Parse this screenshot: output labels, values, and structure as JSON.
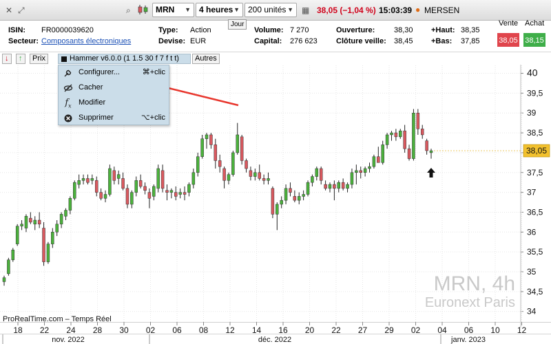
{
  "toolbar": {
    "symbol": "MRN",
    "timeframe": "4 heures",
    "units": "200 unités",
    "price_change": "38,05 (−1,04 %)",
    "time": "15:03:39",
    "instrument_name": "MERSEN"
  },
  "info": {
    "isin_label": "ISIN:",
    "isin_value": "FR0000039620",
    "sector_label": "Secteur:",
    "sector_value": "Composants électroniques",
    "type_label": "Type:",
    "type_value": "Action",
    "currency_label": "Devise:",
    "currency_value": "EUR",
    "day_button": "Jour",
    "volume_label": "Volume:",
    "volume_value": "7 270",
    "capital_label": "Capital:",
    "capital_value": "276 623",
    "open_label": "Ouverture:",
    "open_value": "38,30",
    "prev_close_label": "Clôture veille:",
    "prev_close_value": "38,45",
    "high_label": "+Haut:",
    "high_value": "38,35",
    "low_label": "+Bas:",
    "low_value": "37,85",
    "sell_label": "Vente",
    "sell_value": "38,05",
    "buy_label": "Achat",
    "buy_value": "38,15"
  },
  "legend_bar": {
    "price_label": "Prix",
    "indicator_label": "Hammer v6.0.0 (1 1.5 30 f 7 f t t)",
    "others_label": "Autres"
  },
  "context_menu": {
    "items": [
      {
        "label": "Configurer...",
        "shortcut": "⌘+clic",
        "icon": "wrench-icon"
      },
      {
        "label": "Cacher",
        "shortcut": "",
        "icon": "eye-slash-icon"
      },
      {
        "label": "Modifier",
        "shortcut": "",
        "icon": "function-icon"
      },
      {
        "label": "Supprimer",
        "shortcut": "⌥+clic",
        "icon": "delete-icon"
      }
    ]
  },
  "colors": {
    "bull": "#4bb13c",
    "bear": "#d9595f",
    "wick": "#222222",
    "price_tag": "#f2c12e",
    "sell": "#e0454c",
    "buy": "#3fae49",
    "arrow": "#e8372e",
    "grid": "#e6e6e6"
  },
  "chart_data": {
    "type": "candlestick",
    "ylim": [
      33.7,
      40.2
    ],
    "yticks": [
      "34",
      "34,5",
      "35",
      "35,5",
      "36",
      "36,5",
      "37",
      "37,5",
      "38",
      "38,5",
      "39",
      "39,5",
      "40"
    ],
    "yticks_values": [
      34,
      34.5,
      35,
      35.5,
      36,
      36.5,
      37,
      37.5,
      38,
      38.5,
      39,
      39.5,
      40
    ],
    "xticks": [
      "18",
      "22",
      "24",
      "28",
      "30",
      "02",
      "06",
      "08",
      "12",
      "14",
      "16",
      "20",
      "22",
      "27",
      "29",
      "02",
      "04",
      "06",
      "10",
      "12"
    ],
    "month_labels": [
      "nov. 2022",
      "déc. 2022",
      "janv. 2023"
    ],
    "last_price": "38,05",
    "last_price_value": 38.05,
    "watermark_symbol": "MRN, 4h",
    "watermark_exchange": "Euronext Paris",
    "source": "ProRealTime.com – Temps Réel",
    "candles": [
      [
        34.75,
        34.9,
        34.65,
        34.85
      ],
      [
        34.95,
        35.35,
        34.9,
        35.3
      ],
      [
        35.3,
        35.6,
        35.25,
        35.55
      ],
      [
        35.7,
        36.2,
        35.65,
        36.15
      ],
      [
        36.15,
        36.3,
        36.05,
        36.2
      ],
      [
        36.1,
        36.45,
        36.0,
        36.4
      ],
      [
        36.35,
        36.5,
        36.2,
        36.25
      ],
      [
        36.2,
        36.4,
        36.05,
        36.3
      ],
      [
        36.3,
        36.5,
        36.1,
        36.2
      ],
      [
        36.1,
        36.25,
        35.15,
        35.25
      ],
      [
        35.25,
        35.75,
        35.2,
        35.7
      ],
      [
        35.7,
        36.1,
        35.6,
        36.0
      ],
      [
        36.0,
        36.3,
        35.9,
        36.2
      ],
      [
        36.2,
        36.5,
        36.1,
        36.45
      ],
      [
        36.4,
        36.6,
        36.3,
        36.55
      ],
      [
        36.55,
        36.9,
        36.45,
        36.85
      ],
      [
        36.85,
        37.3,
        36.8,
        37.25
      ],
      [
        37.2,
        37.45,
        37.1,
        37.3
      ],
      [
        37.3,
        37.45,
        37.2,
        37.35
      ],
      [
        37.35,
        37.45,
        37.2,
        37.25
      ],
      [
        37.3,
        37.45,
        37.2,
        37.35
      ],
      [
        37.3,
        37.4,
        36.9,
        37.0
      ],
      [
        37.0,
        37.1,
        36.8,
        36.85
      ],
      [
        36.85,
        37.05,
        36.75,
        36.95
      ],
      [
        36.95,
        37.7,
        36.9,
        37.6
      ],
      [
        37.55,
        37.65,
        37.2,
        37.3
      ],
      [
        37.35,
        37.55,
        37.2,
        37.45
      ],
      [
        37.35,
        37.5,
        37.05,
        37.1
      ],
      [
        37.1,
        37.2,
        36.6,
        36.7
      ],
      [
        36.7,
        37.05,
        36.6,
        37.0
      ],
      [
        37.0,
        37.4,
        36.9,
        37.3
      ],
      [
        37.3,
        37.45,
        37.1,
        37.15
      ],
      [
        37.15,
        37.25,
        36.95,
        37.05
      ],
      [
        37.0,
        37.1,
        36.6,
        36.85
      ],
      [
        36.9,
        37.2,
        36.8,
        37.15
      ],
      [
        37.1,
        37.7,
        37.0,
        37.6
      ],
      [
        37.55,
        37.7,
        37.0,
        37.1
      ],
      [
        37.05,
        37.2,
        36.8,
        37.0
      ],
      [
        37.0,
        37.1,
        36.85,
        37.05
      ],
      [
        37.0,
        37.15,
        36.8,
        36.9
      ],
      [
        36.95,
        37.1,
        36.85,
        37.0
      ],
      [
        37.0,
        37.15,
        36.8,
        36.95
      ],
      [
        37.0,
        37.25,
        36.9,
        37.2
      ],
      [
        37.2,
        37.6,
        37.1,
        37.5
      ],
      [
        37.5,
        38.0,
        37.4,
        37.9
      ],
      [
        37.9,
        38.45,
        37.85,
        38.35
      ],
      [
        38.35,
        38.5,
        38.1,
        38.45
      ],
      [
        38.45,
        38.5,
        38.1,
        38.2
      ],
      [
        38.2,
        38.35,
        37.6,
        37.8
      ],
      [
        37.8,
        37.95,
        37.5,
        37.65
      ],
      [
        37.6,
        37.65,
        37.1,
        37.3
      ],
      [
        37.3,
        37.5,
        37.2,
        37.45
      ],
      [
        37.45,
        38.05,
        37.4,
        38.0
      ],
      [
        38.0,
        38.75,
        37.95,
        38.45
      ],
      [
        38.4,
        38.45,
        37.7,
        37.8
      ],
      [
        37.8,
        37.85,
        37.5,
        37.6
      ],
      [
        37.55,
        37.65,
        37.3,
        37.4
      ],
      [
        37.4,
        37.6,
        37.3,
        37.5
      ],
      [
        37.5,
        37.7,
        37.3,
        37.35
      ],
      [
        37.35,
        37.45,
        37.2,
        37.3
      ],
      [
        37.3,
        37.5,
        37.2,
        37.35
      ],
      [
        37.1,
        37.15,
        36.35,
        36.45
      ],
      [
        36.45,
        36.75,
        36.05,
        36.7
      ],
      [
        36.7,
        36.9,
        36.6,
        36.8
      ],
      [
        36.8,
        37.2,
        36.7,
        37.1
      ],
      [
        37.1,
        37.25,
        36.9,
        37.0
      ],
      [
        36.9,
        37.05,
        36.75,
        36.8
      ],
      [
        36.8,
        37.0,
        36.7,
        36.9
      ],
      [
        36.9,
        37.05,
        36.8,
        36.95
      ],
      [
        36.95,
        37.3,
        36.9,
        37.25
      ],
      [
        37.25,
        37.45,
        37.15,
        37.4
      ],
      [
        37.4,
        37.65,
        37.3,
        37.6
      ],
      [
        37.6,
        37.65,
        37.2,
        37.3
      ],
      [
        37.2,
        37.3,
        37.05,
        37.1
      ],
      [
        37.1,
        37.25,
        37.0,
        37.2
      ],
      [
        37.2,
        37.3,
        36.8,
        37.1
      ],
      [
        37.1,
        37.3,
        37.0,
        37.25
      ],
      [
        37.25,
        37.35,
        37.05,
        37.1
      ],
      [
        37.1,
        37.25,
        37.0,
        37.2
      ],
      [
        37.2,
        37.6,
        37.1,
        37.5
      ],
      [
        37.5,
        37.7,
        37.2,
        37.55
      ],
      [
        37.55,
        37.65,
        37.35,
        37.5
      ],
      [
        37.5,
        37.65,
        37.4,
        37.6
      ],
      [
        37.6,
        37.75,
        37.5,
        37.65
      ],
      [
        37.65,
        37.95,
        37.6,
        37.9
      ],
      [
        37.9,
        38.15,
        37.75,
        37.75
      ],
      [
        37.75,
        38.3,
        37.7,
        38.2
      ],
      [
        38.2,
        38.5,
        38.1,
        38.45
      ],
      [
        38.45,
        38.55,
        38.3,
        38.5
      ],
      [
        38.5,
        38.6,
        38.3,
        38.4
      ],
      [
        38.4,
        38.6,
        38.35,
        38.55
      ],
      [
        38.55,
        38.7,
        38.0,
        38.1
      ],
      [
        38.1,
        38.2,
        37.8,
        37.85
      ],
      [
        37.85,
        39.1,
        37.8,
        39.0
      ],
      [
        39.0,
        39.1,
        38.45,
        38.6
      ],
      [
        38.6,
        38.7,
        38.35,
        38.45
      ],
      [
        38.3,
        38.35,
        37.95,
        38.05
      ],
      [
        38.0,
        38.1,
        37.85,
        38.05
      ]
    ]
  }
}
